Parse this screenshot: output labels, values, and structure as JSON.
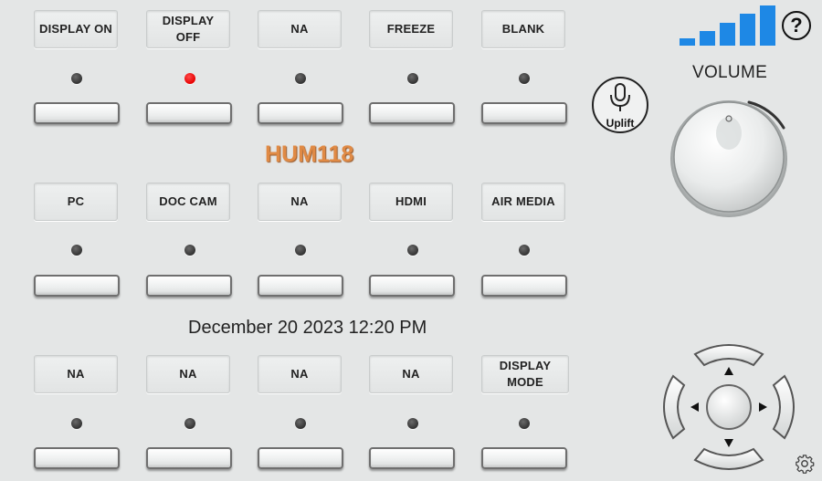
{
  "room": "HUM118",
  "datetime": "December 20 2023 12:20 PM",
  "volume_label": "VOLUME",
  "mic_label": "Uplift",
  "help_label": "?",
  "rows": [
    {
      "buttons": [
        {
          "label": "DISPLAY ON",
          "led": "off"
        },
        {
          "label": "DISPLAY OFF",
          "led": "on"
        },
        {
          "label": "NA",
          "led": "off"
        },
        {
          "label": "FREEZE",
          "led": "off"
        },
        {
          "label": "BLANK",
          "led": "off"
        }
      ]
    },
    {
      "buttons": [
        {
          "label": "PC",
          "led": "off"
        },
        {
          "label": "DOC CAM",
          "led": "off"
        },
        {
          "label": "NA",
          "led": "off"
        },
        {
          "label": "HDMI",
          "led": "off"
        },
        {
          "label": "AIR MEDIA",
          "led": "off"
        }
      ]
    },
    {
      "buttons": [
        {
          "label": "NA",
          "led": "off"
        },
        {
          "label": "NA",
          "led": "off"
        },
        {
          "label": "NA",
          "led": "off"
        },
        {
          "label": "NA",
          "led": "off"
        },
        {
          "label": "DISPLAY MODE",
          "led": "off"
        }
      ]
    }
  ],
  "icons": {
    "signal": "signal-strength-icon",
    "help": "help-icon",
    "mic": "microphone-icon",
    "knob": "volume-knob",
    "dpad": "directional-pad",
    "settings": "gear-icon"
  },
  "colors": {
    "led_on": "#e60000",
    "room_text": "#e08a45",
    "signal": "#1e88e5"
  }
}
